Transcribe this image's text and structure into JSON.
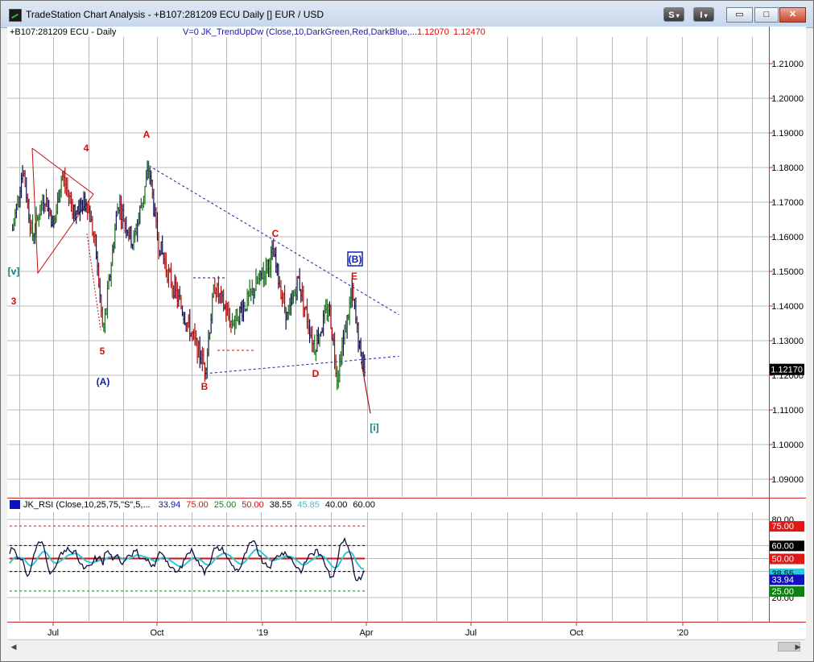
{
  "window": {
    "title": "TradeStation Chart Analysis - +B107:281209 ECU Daily [] EUR / USD",
    "buttons": {
      "s": "S",
      "i": "I",
      "minimize": "▭",
      "maximize": "□",
      "close": "✕"
    }
  },
  "price_header": {
    "symbol": "+B107:281209 ECU - Daily",
    "indicator": "V=0  JK_TrendUpDw  (Close,10,DarkGreen,Red,DarkBlue,...",
    "value1": "1.12070",
    "value2": "1.12470"
  },
  "rsi_header": {
    "name": "JK_RSI (Close,10,25,75,\"S\",5,...",
    "values": [
      {
        "text": "33.94",
        "color": "#1010c0"
      },
      {
        "text": "75.00",
        "color": "#d01010"
      },
      {
        "text": "25.00",
        "color": "#108010"
      },
      {
        "text": "50.00",
        "color": "#d01010"
      },
      {
        "text": "38.55",
        "color": "#000000"
      },
      {
        "text": "45.85",
        "color": "#30c8d8"
      },
      {
        "text": "40.00",
        "color": "#000000"
      },
      {
        "text": "60.00",
        "color": "#000000"
      }
    ]
  },
  "price_axis": {
    "ticks": [
      "1.21000",
      "1.20000",
      "1.19000",
      "1.18000",
      "1.17000",
      "1.16000",
      "1.15000",
      "1.14000",
      "1.13000",
      "1.12000",
      "1.11000",
      "1.10000",
      "1.09000"
    ],
    "last_price": "1.12170"
  },
  "rsi_axis": {
    "ticks": [
      "80.00",
      "20.00"
    ],
    "badges": [
      {
        "text": "75.00",
        "bg": "#e01818",
        "fg": "#ffffff"
      },
      {
        "text": "60.00",
        "bg": "#000000",
        "fg": "#ffffff"
      },
      {
        "text": "50.00",
        "bg": "#e01818",
        "fg": "#ffffff"
      },
      {
        "text": "38.55",
        "bg": "#30c8d8",
        "fg": "#000000"
      },
      {
        "text": "33.94",
        "bg": "#1010c0",
        "fg": "#ffffff"
      },
      {
        "text": "25.00",
        "bg": "#108010",
        "fg": "#ffffff"
      }
    ]
  },
  "time_axis": [
    "Jul",
    "Oct",
    "'19",
    "Apr",
    "Jul",
    "Oct",
    "'20"
  ],
  "wave_labels": [
    {
      "text": "4",
      "color": "#d01010"
    },
    {
      "text": "A",
      "color": "#d01010"
    },
    {
      "text": "[v]",
      "color": "#138080"
    },
    {
      "text": "3",
      "color": "#d01010"
    },
    {
      "text": "5",
      "color": "#d01010"
    },
    {
      "text": "(A)",
      "color": "#1020b0"
    },
    {
      "text": "B",
      "color": "#d01010"
    },
    {
      "text": "C",
      "color": "#d01010"
    },
    {
      "text": "D",
      "color": "#d01010"
    },
    {
      "text": "E",
      "color": "#d01010"
    },
    {
      "text": "(B)",
      "color": "#1020b0"
    },
    {
      "text": "[i]",
      "color": "#138080"
    }
  ],
  "colors": {
    "up_bar": "#1a6e1a",
    "down_bar": "#b01010",
    "neutral_bar": "#101050",
    "grid": "#b8b8b8",
    "trendline": "#1a1aa0",
    "rsi_main": "#101040",
    "rsi_signal": "#30c8d8",
    "rsi_mid": "#d01010"
  },
  "chart_data": {
    "type": "ohlc",
    "symbol": "EUR / USD",
    "timeframe": "Daily",
    "ylim": [
      1.085,
      1.215
    ],
    "last_price": 1.1217,
    "path": [
      [
        "2018-05-28",
        1.162
      ],
      [
        "2018-06-06",
        1.18
      ],
      [
        "2018-06-14",
        1.16
      ],
      [
        "2018-06-25",
        1.172
      ],
      [
        "2018-07-03",
        1.163
      ],
      [
        "2018-07-10",
        1.178
      ],
      [
        "2018-07-20",
        1.168
      ],
      [
        "2018-08-01",
        1.17
      ],
      [
        "2018-08-08",
        1.158
      ],
      [
        "2018-08-15",
        1.132
      ],
      [
        "2018-08-28",
        1.17
      ],
      [
        "2018-09-10",
        1.158
      ],
      [
        "2018-09-24",
        1.18
      ],
      [
        "2018-10-01",
        1.16
      ],
      [
        "2018-10-10",
        1.15
      ],
      [
        "2018-10-31",
        1.132
      ],
      [
        "2018-11-12",
        1.122
      ],
      [
        "2018-11-20",
        1.146
      ],
      [
        "2018-12-05",
        1.135
      ],
      [
        "2018-12-20",
        1.142
      ],
      [
        "2019-01-10",
        1.155
      ],
      [
        "2019-01-23",
        1.136
      ],
      [
        "2019-02-01",
        1.148
      ],
      [
        "2019-02-15",
        1.128
      ],
      [
        "2019-02-28",
        1.14
      ],
      [
        "2019-03-07",
        1.12
      ],
      [
        "2019-03-20",
        1.144
      ],
      [
        "2019-03-28",
        1.124
      ],
      [
        "2019-04-01",
        1.1217
      ]
    ],
    "trendlines": [
      {
        "name": "upper",
        "from": [
          "2018-09-24",
          1.1805
        ],
        "to": [
          "2019-04-30",
          1.1375
        ]
      },
      {
        "name": "lower",
        "from": [
          "2018-11-12",
          1.1205
        ],
        "to": [
          "2019-04-30",
          1.1255
        ]
      }
    ],
    "rsi": {
      "levels": [
        75,
        60,
        50,
        40,
        25
      ],
      "last": 33.94,
      "signal_last": 38.55
    }
  }
}
